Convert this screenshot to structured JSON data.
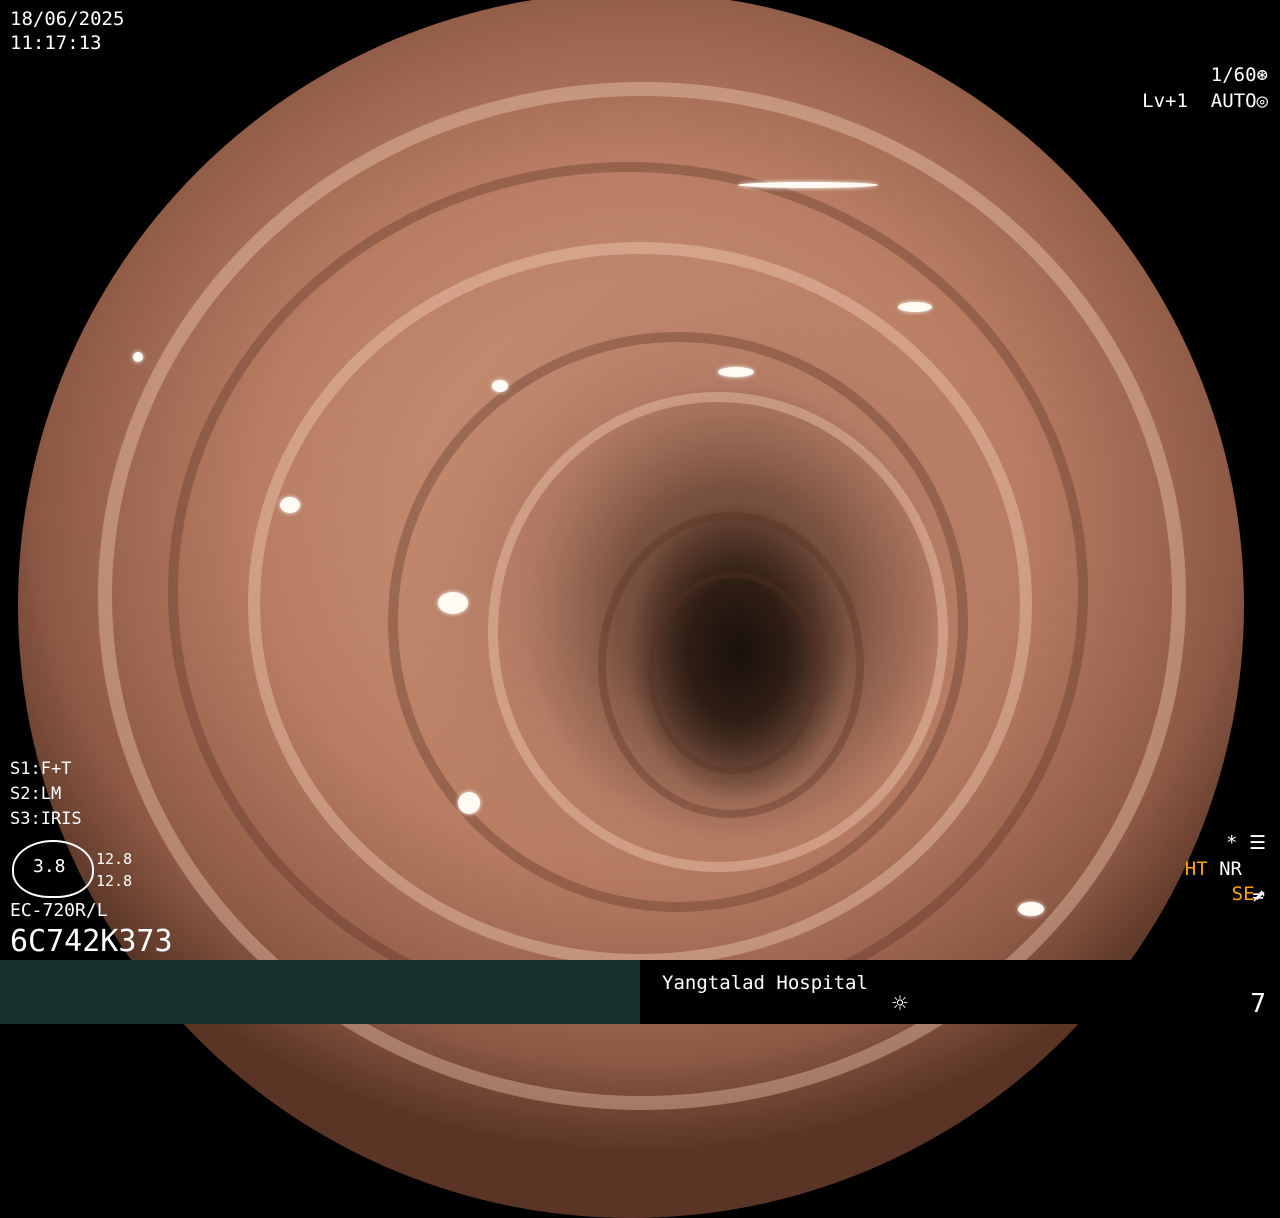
{
  "datetime": {
    "date": "18/06/2025",
    "time": "11:17:13"
  },
  "top_right": {
    "shutter": "1/60",
    "shutter_icon": "aperture-icon",
    "level": "Lv+1",
    "mode": "AUTO",
    "mode_icon": "iris-icon"
  },
  "left_panel": {
    "s1": "S1:F+T",
    "s2": "S2:LM",
    "s3": "S3:IRIS",
    "gauge_value": "3.8",
    "gauge_top": "12.8",
    "gauge_bottom": "12.8",
    "scope_model": "EC-720R/L",
    "serial": "6C742K373"
  },
  "right_panel": {
    "star": "*",
    "settings_icon": "settings-sliders-icon",
    "ht": "HT",
    "nr": "NR",
    "se": "SE",
    "se_icon": "structure-enhance-icon",
    "misc_icon": "not-equal-icon"
  },
  "bottom": {
    "hospital": "Yangtalad Hospital",
    "light_icon": "sun-icon",
    "counter": "7"
  },
  "colors": {
    "orange_label": "#ffa500",
    "bottom_bar": "#16302e"
  }
}
